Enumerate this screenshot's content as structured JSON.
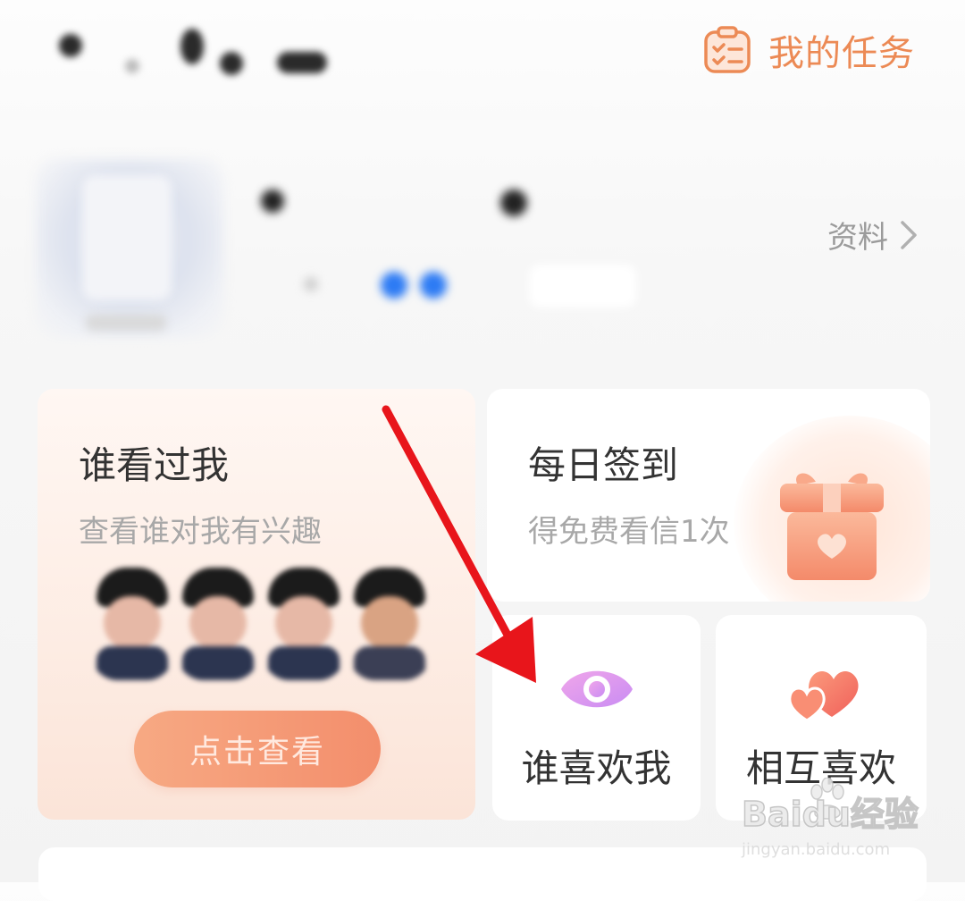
{
  "header": {
    "task_label": "我的任务",
    "task_icon": "task-clipboard-icon"
  },
  "profile": {
    "detail_link": "资料",
    "chevron_icon": "chevron-right-icon"
  },
  "cards": {
    "visitors": {
      "title": "谁看过我",
      "subtitle": "查看谁对我有兴趣",
      "button": "点击查看"
    },
    "signin": {
      "title": "每日签到",
      "subtitle": "得免费看信1次",
      "icon": "gift-icon"
    },
    "likes_me": {
      "label": "谁喜欢我",
      "icon": "eye-icon"
    },
    "mutual": {
      "label": "相互喜欢",
      "icon": "double-heart-icon"
    }
  },
  "watermark": {
    "logo": "Baidu经验",
    "url": "jingyan.baidu.com"
  },
  "colors": {
    "accent": "#ec8a55",
    "button": "#f38e6c",
    "eye": "#d98af0",
    "heart": "#f3735f",
    "arrow": "#e8151b"
  }
}
